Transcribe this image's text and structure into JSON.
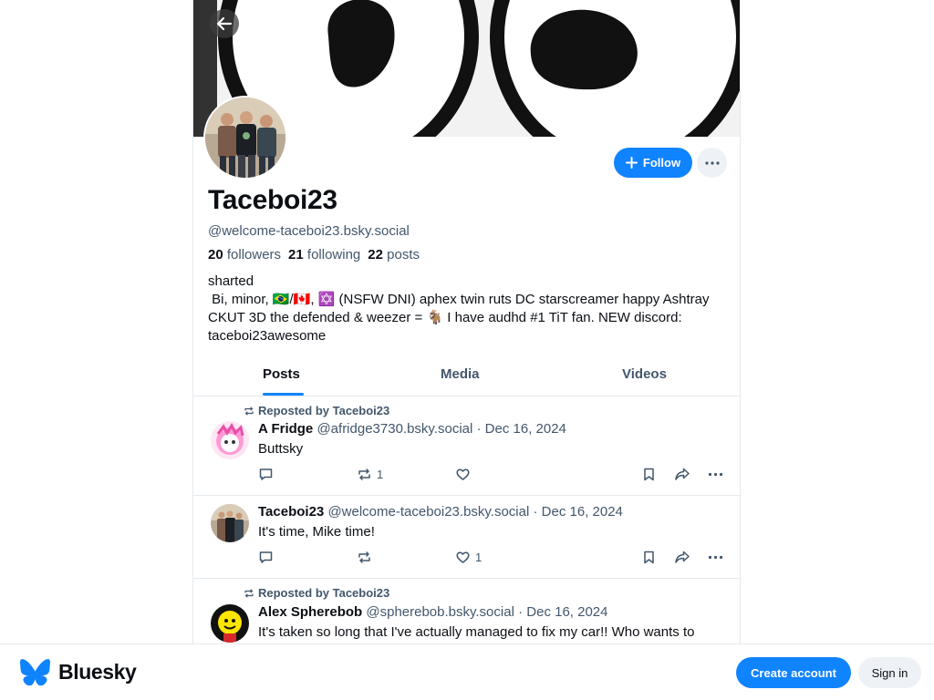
{
  "profile": {
    "display_name": "Taceboi23",
    "handle": "@welcome-taceboi23.bsky.social",
    "followers_count": "20",
    "followers_label": "followers",
    "following_count": "21",
    "following_label": "following",
    "posts_count": "22",
    "posts_label": "posts",
    "bio": "sharted\n Bi, minor, 🇧🇷/🇨🇦, ✡️ (NSFW DNI) aphex twin ruts DC starscreamer happy Ashtray CKUT 3D the defended & weezer = 🐐 I have audhd #1 TiT fan. NEW discord: taceboi23awesome",
    "follow_label": "Follow"
  },
  "tabs": [
    "Posts",
    "Media",
    "Videos"
  ],
  "active_tab": "Posts",
  "feed": [
    {
      "repost_label": "Reposted by Taceboi23",
      "name": "A Fridge",
      "handle": "@afridge3730.bsky.social",
      "date": "Dec 16, 2024",
      "text": "Buttsky",
      "reposts": "1",
      "likes": ""
    },
    {
      "repost_label": "",
      "name": "Taceboi23",
      "handle": "@welcome-taceboi23.bsky.social",
      "date": "Dec 16, 2024",
      "text": "It's time, Mike time!",
      "reposts": "",
      "likes": "1"
    },
    {
      "repost_label": "Reposted by Taceboi23",
      "name": "Alex Spherebob",
      "handle": "@spherebob.bsky.social",
      "date": "Dec 16, 2024",
      "text": "It's taken so long that I've actually managed to fix my car!! Who wants to",
      "reposts": "",
      "likes": ""
    }
  ],
  "bottom_bar": {
    "brand": "Bluesky",
    "create_account": "Create account",
    "sign_in": "Sign in"
  },
  "colors": {
    "accent": "#1083fe",
    "muted_text": "#42576c",
    "border": "#e3e8ee"
  }
}
